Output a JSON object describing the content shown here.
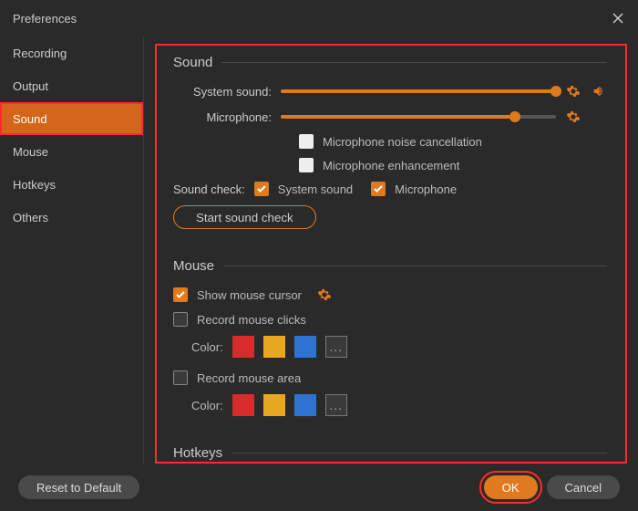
{
  "window": {
    "title": "Preferences"
  },
  "sidebar": {
    "items": [
      {
        "label": "Recording"
      },
      {
        "label": "Output"
      },
      {
        "label": "Sound"
      },
      {
        "label": "Mouse"
      },
      {
        "label": "Hotkeys"
      },
      {
        "label": "Others"
      }
    ],
    "active_index": 2
  },
  "sound": {
    "heading": "Sound",
    "system_label": "System sound:",
    "system_value": 100,
    "mic_label": "Microphone:",
    "mic_value": 85,
    "noise_cancel_label": "Microphone noise cancellation",
    "noise_cancel_checked": false,
    "enhancement_label": "Microphone enhancement",
    "enhancement_checked": false,
    "check_label": "Sound check:",
    "check_system_label": "System sound",
    "check_system_checked": true,
    "check_mic_label": "Microphone",
    "check_mic_checked": true,
    "start_check_label": "Start sound check"
  },
  "mouse": {
    "heading": "Mouse",
    "show_cursor_label": "Show mouse cursor",
    "show_cursor_checked": true,
    "record_clicks_label": "Record mouse clicks",
    "record_clicks_checked": false,
    "record_area_label": "Record mouse area",
    "record_area_checked": false,
    "color_label": "Color:",
    "swatches": [
      "#d62c2c",
      "#e9a71f",
      "#2e73d0"
    ],
    "more_label": "..."
  },
  "hotkeys": {
    "heading": "Hotkeys"
  },
  "footer": {
    "reset_label": "Reset to Default",
    "ok_label": "OK",
    "cancel_label": "Cancel"
  },
  "colors": {
    "accent": "#e07a1f",
    "highlight": "#ff2a2a"
  }
}
